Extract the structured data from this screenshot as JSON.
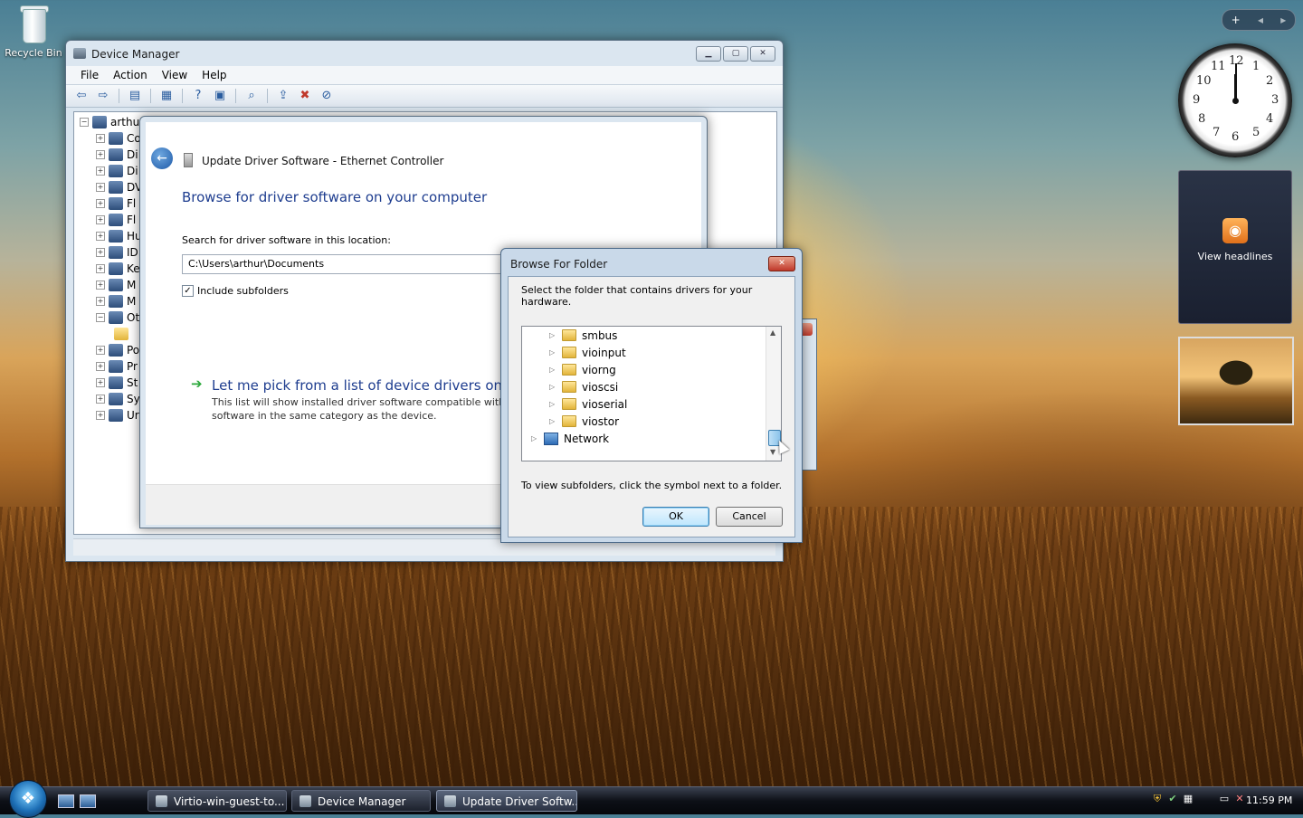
{
  "desktop": {
    "recycle_bin_label": "Recycle Bin"
  },
  "device_manager": {
    "title": "Device Manager",
    "menu": [
      "File",
      "Action",
      "View",
      "Help"
    ],
    "tree_root": "arthur",
    "tree_items": [
      "Co",
      "Di",
      "Di",
      "DV",
      "Fl",
      "Fl",
      "Hu",
      "ID",
      "Ke",
      "M",
      "M",
      "Ot",
      "",
      "Po",
      "Pr",
      "St",
      "Sy",
      "Ur"
    ]
  },
  "update_driver": {
    "title": "Update Driver Software - Ethernet Controller",
    "heading": "Browse for driver software on your computer",
    "search_label": "Search for driver software in this location:",
    "path_value": "C:\\Users\\arthur\\Documents",
    "include_subfolders": "Include subfolders",
    "include_checked": true,
    "pick_link": "Let me pick from a list of device drivers on my",
    "pick_desc_1": "This list will show installed driver software compatible with th",
    "pick_desc_2": "software in the same category as the device."
  },
  "browse_folder": {
    "title": "Browse For Folder",
    "description": "Select the folder that contains drivers for your hardware.",
    "folders": [
      "smbus",
      "vioinput",
      "viorng",
      "vioscsi",
      "vioserial",
      "viostor"
    ],
    "network_label": "Network",
    "hint": "To view subfolders, click the symbol next to a folder.",
    "ok_label": "OK",
    "cancel_label": "Cancel"
  },
  "sidebar": {
    "feed_label": "View headlines",
    "clock_numbers": [
      "12",
      "1",
      "2",
      "3",
      "4",
      "5",
      "6",
      "7",
      "8",
      "9",
      "10",
      "11"
    ]
  },
  "taskbar": {
    "tasks": [
      "Virtio-win-guest-to...",
      "Device Manager",
      "Update Driver Softw..."
    ],
    "time": "11:59 PM"
  },
  "colors": {
    "link_blue": "#1e3d8f",
    "close_red": "#c0392b",
    "accent": "#3c7fb1"
  }
}
